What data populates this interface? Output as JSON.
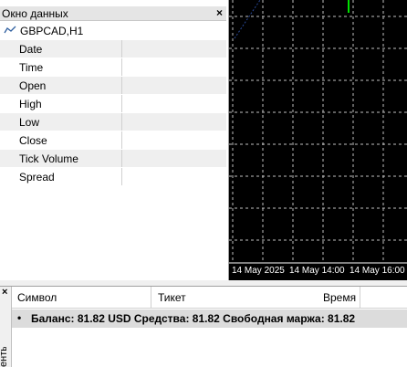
{
  "data_window": {
    "title": "Окно данных",
    "close_glyph": "×",
    "symbol": "GBPCAD,H1",
    "rows": [
      {
        "label": "Date",
        "value": ""
      },
      {
        "label": "Time",
        "value": ""
      },
      {
        "label": "Open",
        "value": ""
      },
      {
        "label": "High",
        "value": ""
      },
      {
        "label": "Low",
        "value": ""
      },
      {
        "label": "Close",
        "value": ""
      },
      {
        "label": "Tick Volume",
        "value": ""
      },
      {
        "label": "Spread",
        "value": ""
      }
    ]
  },
  "chart": {
    "background": "#000000",
    "grid_color": "#c0c0c0",
    "time_labels": [
      "14 May 2025",
      "14 May 14:00",
      "14 May 16:00"
    ]
  },
  "terminal": {
    "close_glyph": "×",
    "side_tab": "енты",
    "columns": [
      "Символ",
      "Тикет",
      "Время"
    ],
    "balance_line": "Баланс: 81.82 USD  Средства: 81.82  Свободная маржа: 81.82",
    "bullet": "•"
  }
}
